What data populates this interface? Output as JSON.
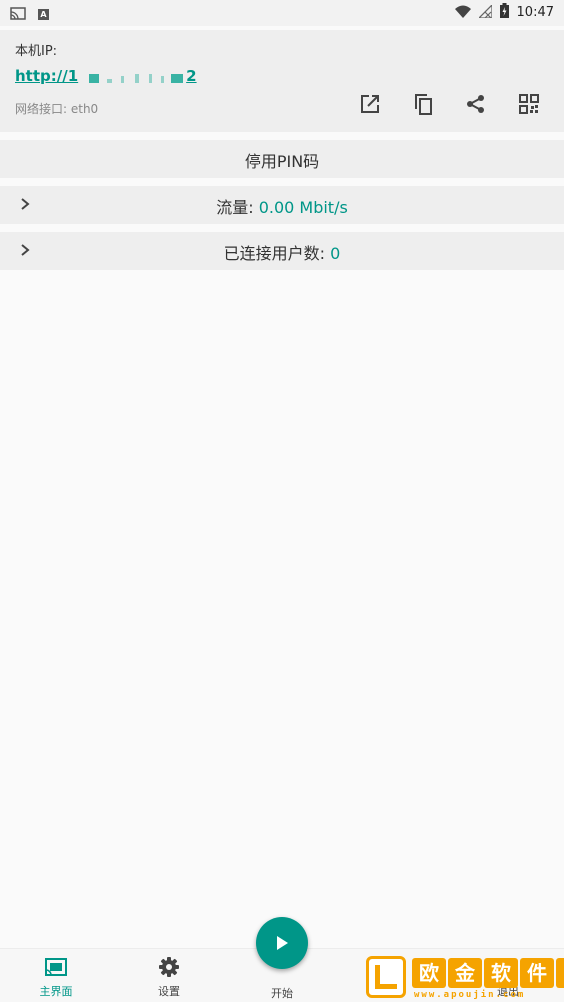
{
  "status_bar": {
    "time": "10:47",
    "a_badge": "A"
  },
  "ip_card": {
    "label": "本机IP:",
    "ip_prefix": "http://1",
    "ip_suffix": "2",
    "interface": "网络接口: eth0"
  },
  "pin_row": {
    "label": "停用PIN码"
  },
  "flow_row": {
    "label": "流量:",
    "value": "0.00 Mbit/s"
  },
  "users_row": {
    "label": "已连接用户数:",
    "value": "0"
  },
  "bottom_nav": {
    "items": [
      {
        "label": "主界面",
        "icon": "cast-icon"
      },
      {
        "label": "设置",
        "icon": "gear-icon"
      },
      {
        "label": "开始",
        "icon": "play-icon"
      },
      {
        "label": "退出",
        "icon": "exit-icon"
      }
    ]
  },
  "watermark": {
    "title_chars": [
      "欧",
      "金",
      "软",
      "件",
      "园"
    ],
    "url": "www.apoujin.com"
  },
  "colors": {
    "accent": "#009688",
    "card": "#eeeeee",
    "background": "#fafafa",
    "watermark": "#f5a300"
  }
}
